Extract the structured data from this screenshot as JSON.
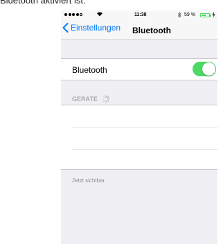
{
  "caption": "Bluetooth aktiviert ist.",
  "status_bar": {
    "time": "11:38",
    "battery_percent": "59 %",
    "battery_level": 0.59,
    "accent_color": "#4cd964"
  },
  "nav": {
    "back_label": "Einstellungen",
    "title": "Bluetooth",
    "tint_color": "#007aff"
  },
  "bluetooth_row": {
    "label": "Bluetooth",
    "enabled": true
  },
  "devices_section": {
    "header": "GERÄTE",
    "loading": true,
    "items": []
  },
  "footer": {
    "text": "Jetzt sichtbar"
  }
}
